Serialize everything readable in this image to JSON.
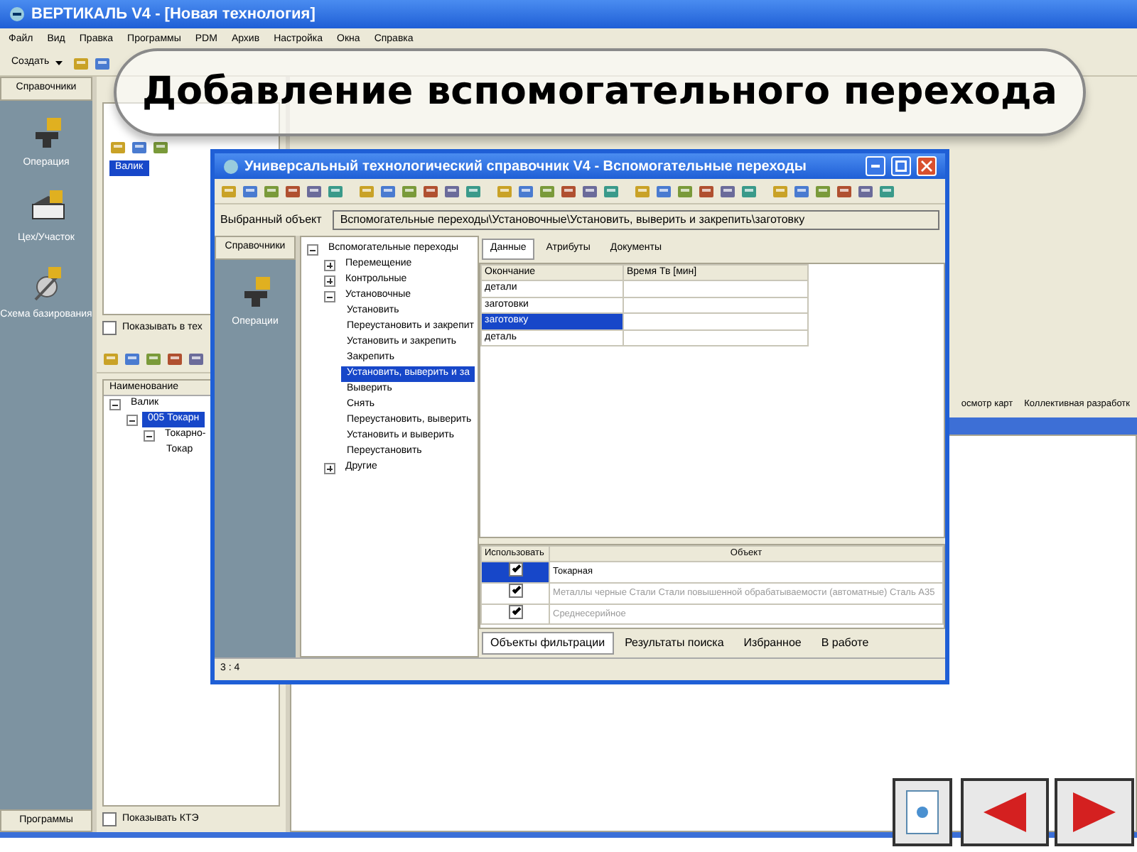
{
  "slide_title": "Добавление вспомогательного перехода",
  "app": {
    "title": "ВЕРТИКАЛЬ V4 - [Новая технология]",
    "menu": [
      "Файл",
      "Вид",
      "Правка",
      "Программы",
      "PDM",
      "Архив",
      "Настройка",
      "Окна",
      "Справка"
    ],
    "create_button": "Создать",
    "sidebar": {
      "header": "Справочники",
      "items": [
        {
          "label": "Операция",
          "kind": "anvil"
        },
        {
          "label": "Цех/Участок",
          "kind": "workshop"
        },
        {
          "label": "Схема базирования",
          "kind": "fixture"
        }
      ],
      "footer": "Программы"
    },
    "top_tree": [
      {
        "label": "Валик",
        "selected": true
      }
    ],
    "show_in_tech": {
      "label": "Показывать в тех",
      "checked": false
    },
    "structure_header": "Наименование",
    "structure_tree": [
      {
        "label": "Валик",
        "expanded": true,
        "selected": false,
        "children": [
          {
            "label": "005 Токарн",
            "expanded": true,
            "selected": true,
            "children": [
              {
                "label": "Токарно-",
                "expanded": true,
                "selected": false,
                "children": [
                  {
                    "label": "Токар",
                    "selected": false
                  }
                ]
              }
            ]
          }
        ]
      }
    ],
    "show_kte": {
      "label": "Показывать КТЭ",
      "checked": false
    },
    "right_tabs": [
      "осмотр карт",
      "Коллективная разработк"
    ]
  },
  "dialog": {
    "title": "Универсальный технологический справочник V4 - Вспомогательные переходы",
    "selected_object_label": "Выбранный объект",
    "selected_object_value": "Вспомогательные переходы\\Установочные\\Установить, выверить и закрепить\\заготовку",
    "catalogs_header": "Справочники",
    "catalog_item": "Операции",
    "tree": [
      {
        "label": "Вспомогательные переходы",
        "expanded": true,
        "selected": false,
        "children": [
          {
            "label": "Перемещение",
            "expanded": false,
            "selected": false
          },
          {
            "label": "Контрольные",
            "expanded": false,
            "selected": false
          },
          {
            "label": "Установочные",
            "expanded": true,
            "selected": false,
            "children": [
              {
                "label": "Установить",
                "selected": false
              },
              {
                "label": "Переустановить и закрепит",
                "selected": false
              },
              {
                "label": "Установить и закрепить",
                "selected": false
              },
              {
                "label": "Закрепить",
                "selected": false
              },
              {
                "label": "Установить, выверить и за",
                "selected": true
              },
              {
                "label": "Выверить",
                "selected": false
              },
              {
                "label": "Снять",
                "selected": false
              },
              {
                "label": "Переустановить, выверить",
                "selected": false
              },
              {
                "label": "Установить и выверить",
                "selected": false
              },
              {
                "label": "Переустановить",
                "selected": false
              }
            ]
          },
          {
            "label": "Другие",
            "expanded": false,
            "selected": false
          }
        ]
      }
    ],
    "tabs": [
      {
        "label": "Данные",
        "selected": true
      },
      {
        "label": "Атрибуты",
        "selected": false
      },
      {
        "label": "Документы",
        "selected": false
      }
    ],
    "table": {
      "columns": [
        "Окончание",
        "Время Тв [мин]"
      ],
      "rows": [
        {
          "cells": [
            "детали",
            ""
          ],
          "selected": false
        },
        {
          "cells": [
            "заготовки",
            ""
          ],
          "selected": false
        },
        {
          "cells": [
            "заготовку",
            ""
          ],
          "selected": true
        },
        {
          "cells": [
            "деталь",
            ""
          ],
          "selected": false
        }
      ]
    },
    "filter_grid": {
      "columns": [
        "Использовать",
        "Объект"
      ],
      "rows": [
        {
          "checked": true,
          "object": "Токарная",
          "selected": true,
          "disabled": false
        },
        {
          "checked": true,
          "object": "Металлы черные Стали Стали повышенной обрабатываемости (автоматные) Сталь А35",
          "selected": false,
          "disabled": true
        },
        {
          "checked": true,
          "object": "Среднесерийное",
          "selected": false,
          "disabled": true
        }
      ]
    },
    "bottom_tabs": [
      {
        "label": "Объекты фильтрации",
        "selected": true
      },
      {
        "label": "Результаты поиска",
        "selected": false
      },
      {
        "label": "Избранное",
        "selected": false
      },
      {
        "label": "В работе",
        "selected": false
      }
    ],
    "status": "3 : 4"
  }
}
